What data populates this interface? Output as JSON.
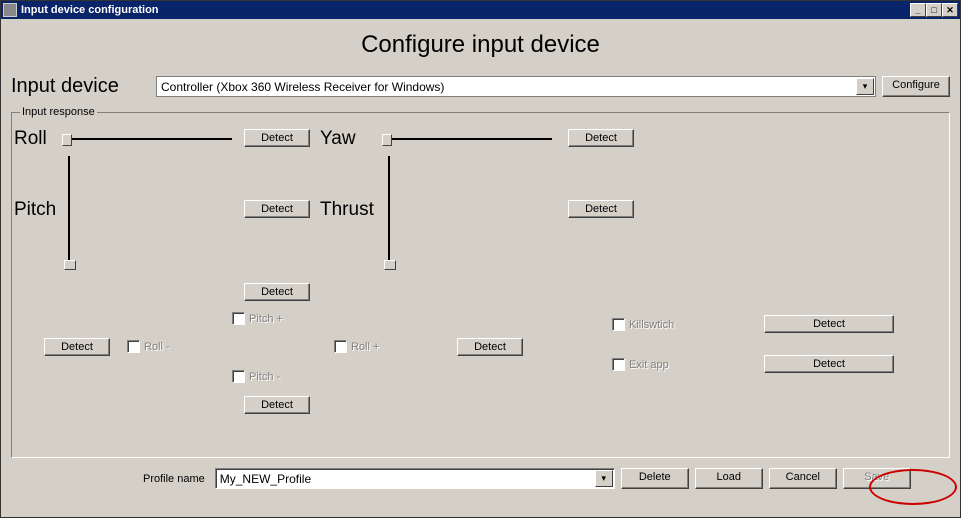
{
  "window": {
    "title": "Input device configuration",
    "min": "_",
    "max": "□",
    "close": "✕"
  },
  "page": {
    "heading": "Configure input device"
  },
  "device": {
    "label": "Input device",
    "selected": "Controller (Xbox 360 Wireless Receiver for Windows)",
    "configure_btn": "Configure"
  },
  "fieldset": {
    "legend": "Input response"
  },
  "axes": {
    "roll": {
      "label": "Roll",
      "detect": "Detect"
    },
    "yaw": {
      "label": "Yaw",
      "detect": "Detect"
    },
    "pitch": {
      "label": "Pitch",
      "detect": "Detect"
    },
    "thrust": {
      "label": "Thrust",
      "detect": "Detect"
    }
  },
  "middle": {
    "pitch_plus": "Pitch +",
    "pitch_minus": "Pitch -",
    "roll_minus": "Roll -",
    "roll_plus": "Roll +",
    "killswitch": "Killswtich",
    "exit_app": "Exit app",
    "detect": "Detect"
  },
  "bottom": {
    "profile_label": "Profile name",
    "profile_value": "My_NEW_Profile",
    "delete_btn": "Delete",
    "load_btn": "Load",
    "cancel_btn": "Cancel",
    "save_btn": "Save"
  }
}
